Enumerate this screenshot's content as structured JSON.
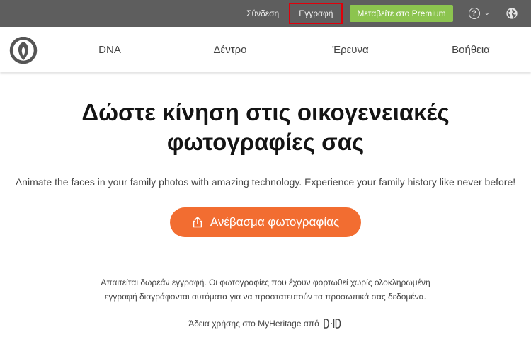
{
  "topbar": {
    "login_label": "Σύνδεση",
    "signup_label": "Εγγραφή",
    "premium_label": "Μεταβείτε στο Premium",
    "help_icon": "question-circle-icon",
    "chevron_icon": "chevron-down-icon",
    "language_icon": "globe-icon",
    "highlight_color": "#e0000b",
    "premium_color": "#8cc44f"
  },
  "nav": {
    "logo_icon": "myheritage-logo",
    "items": [
      {
        "label": "DNA"
      },
      {
        "label": "Δέντρο"
      },
      {
        "label": "Έρευνα"
      },
      {
        "label": "Βοήθεια"
      }
    ]
  },
  "main": {
    "headline": "Δώστε κίνηση στις οικογενειακές φωτογραφίες σας",
    "subtitle": "Animate the faces in your family photos with amazing technology. Experience your family history like never before!",
    "upload_label": "Ανέβασμα φωτογραφίας",
    "upload_icon": "upload-icon",
    "accent_color": "#f26d31",
    "notice": "Απαιτείται δωρεάν εγγραφή. Οι φωτογραφίες που έχουν φορτωθεί χωρίς ολοκληρωμένη εγγραφή διαγράφονται αυτόματα για να προστατευτούν τα προσωπικά σας δεδομένα.",
    "license_text": "Άδεια χρήσης στο MyHeritage από",
    "license_logo": "D-ID"
  }
}
